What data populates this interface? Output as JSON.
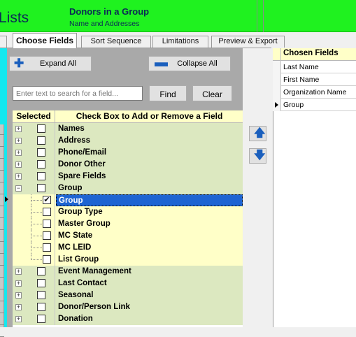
{
  "header": {
    "partial_title": "Lists",
    "title": "Donors in a Group",
    "subtitle": "Name and Addresses"
  },
  "tabs": [
    {
      "label": "Choose Fields",
      "active": true
    },
    {
      "label": "Sort Sequence",
      "active": false
    },
    {
      "label": "Limitations",
      "active": false
    },
    {
      "label": "Preview & Export",
      "active": false
    }
  ],
  "toolbar": {
    "expand_label": "Expand All",
    "collapse_label": "Collapse All",
    "search_placeholder": "Enter text to search for a field...",
    "find_label": "Find",
    "clear_label": "Clear"
  },
  "grid": {
    "col_selected": "Selected",
    "col_fields": "Check Box to Add or Remove a Field",
    "rows": [
      {
        "label": "Names",
        "expander": "+",
        "checked": false,
        "level": 0
      },
      {
        "label": "Address",
        "expander": "+",
        "checked": false,
        "level": 0
      },
      {
        "label": "Phone/Email",
        "expander": "+",
        "checked": false,
        "level": 0
      },
      {
        "label": "Donor Other",
        "expander": "+",
        "checked": false,
        "level": 0
      },
      {
        "label": "Spare Fields",
        "expander": "+",
        "checked": false,
        "level": 0
      },
      {
        "label": "Group",
        "expander": "−",
        "checked": false,
        "level": 0
      },
      {
        "label": "Group",
        "expander": "",
        "checked": true,
        "level": 1,
        "selected": true
      },
      {
        "label": "Group Type",
        "expander": "",
        "checked": false,
        "level": 1
      },
      {
        "label": "Master Group",
        "expander": "",
        "checked": false,
        "level": 1
      },
      {
        "label": "MC State",
        "expander": "",
        "checked": false,
        "level": 1
      },
      {
        "label": "MC LEID",
        "expander": "",
        "checked": false,
        "level": 1
      },
      {
        "label": "List Group",
        "expander": "",
        "checked": false,
        "level": 1
      },
      {
        "label": "Event Management",
        "expander": "+",
        "checked": false,
        "level": 0
      },
      {
        "label": "Last Contact",
        "expander": "+",
        "checked": false,
        "level": 0
      },
      {
        "label": "Seasonal",
        "expander": "+",
        "checked": false,
        "level": 0
      },
      {
        "label": "Donor/Person Link",
        "expander": "+",
        "checked": false,
        "level": 0
      },
      {
        "label": "Donation",
        "expander": "+",
        "checked": false,
        "level": 0
      }
    ]
  },
  "chosen": {
    "header": "Chosen Fields",
    "items": [
      "Last Name",
      "First Name",
      "Organization Name",
      "Group"
    ],
    "current_index": 3
  },
  "colors": {
    "header_bg": "#1ff21f",
    "group_row": "#dce8c0",
    "child_row": "#ffffc8",
    "selection": "#1e64d2",
    "accent": "#1a5fbd"
  },
  "icons": {
    "expand": "plus-icon",
    "collapse": "minus-icon",
    "move_up": "arrow-up-icon",
    "move_down": "arrow-down-icon"
  }
}
